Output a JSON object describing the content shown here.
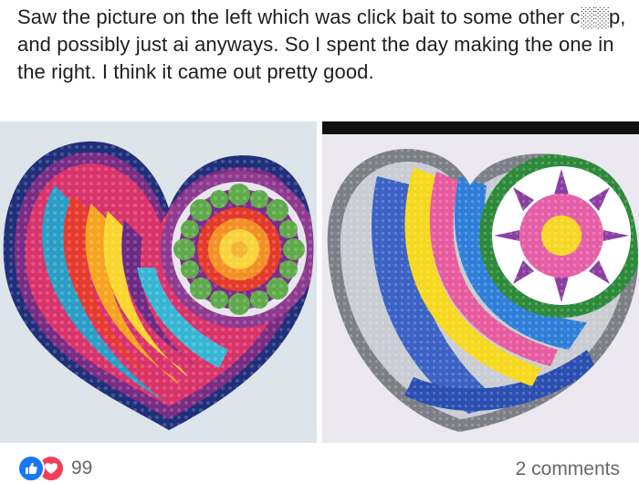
{
  "post": {
    "text": "Saw the picture on the left which was click bait to some other c░░p,  and possibly just ai anyways.  So I spent the day making the one in the right.  I think it came out pretty good."
  },
  "photos": {
    "left": {
      "icon": "crochet-heart-original"
    },
    "right": {
      "icon": "crochet-heart-handmade"
    }
  },
  "footer": {
    "reactions_count": "99",
    "comments_label": "2 comments",
    "like_color": "#1877f2",
    "love_color": "#f33e58"
  }
}
